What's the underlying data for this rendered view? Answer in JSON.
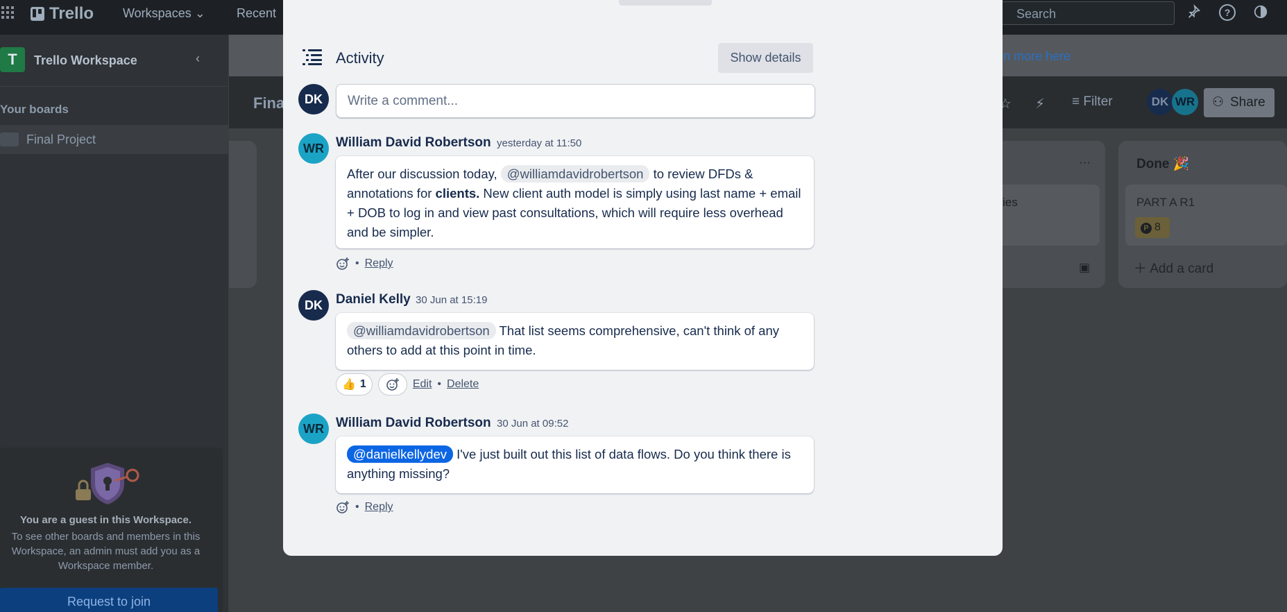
{
  "topbar": {
    "app_name": "Trello",
    "nav": [
      "Workspaces",
      "Recent"
    ],
    "search_placeholder": "Search"
  },
  "sidebar": {
    "workspace_initial": "T",
    "workspace_name": "Trello Workspace",
    "section_title": "Your boards",
    "boards": [
      "Final Project"
    ],
    "guest": {
      "title": "You are a guest in this Workspace.",
      "text": "To see other boards and members in this Workspace, an admin must add you as a Workspace member.",
      "join_label": "Request to join"
    }
  },
  "board": {
    "banner_link": "arn more here",
    "title_fragment": "Fina",
    "filter_label": "Filter",
    "members": [
      "DK",
      "WR"
    ],
    "share_label": "Share",
    "lists": {
      "middle_card_fragment": "ies",
      "done_title": "Done 🎉",
      "done_card": "PART A R1",
      "done_badge_letter": "P",
      "done_badge_count": "8",
      "add_card_label": "Add a card"
    }
  },
  "activity": {
    "title": "Activity",
    "show_details_label": "Show details",
    "current_user_initials": "DK",
    "comment_placeholder": "Write a comment...",
    "comments": [
      {
        "initials": "WR",
        "author": "William David Robertson",
        "time": "yesterday at 11:50",
        "mention": "@williamdavidrobertson",
        "text_before": "After our discussion today,",
        "text_mid": " to review DFDs & annotations for ",
        "text_bold": "clients.",
        "text_after": " New client auth model is simply using last name + email + DOB to log in and view past consultations, which will require less overhead and be simpler.",
        "reply_label": "Reply"
      },
      {
        "initials": "DK",
        "author": "Daniel Kelly",
        "time": "30 Jun at 15:19",
        "mention": "@williamdavidrobertson",
        "text_after": " That list seems comprehensive, can't think of any others to add at this point in time.",
        "reaction_count": "1",
        "edit_label": "Edit",
        "delete_label": "Delete"
      },
      {
        "initials": "WR",
        "author": "William David Robertson",
        "time": "30 Jun at 09:52",
        "mention": "@danielkellydev",
        "text_after": " I've just built out this list of data flows. Do you think there is anything missing?",
        "reply_label": "Reply"
      }
    ]
  },
  "colors": {
    "dk_avatar": "#172b4d",
    "wr_avatar": "#1ba3c6",
    "mention_self": "#0c66e4"
  }
}
